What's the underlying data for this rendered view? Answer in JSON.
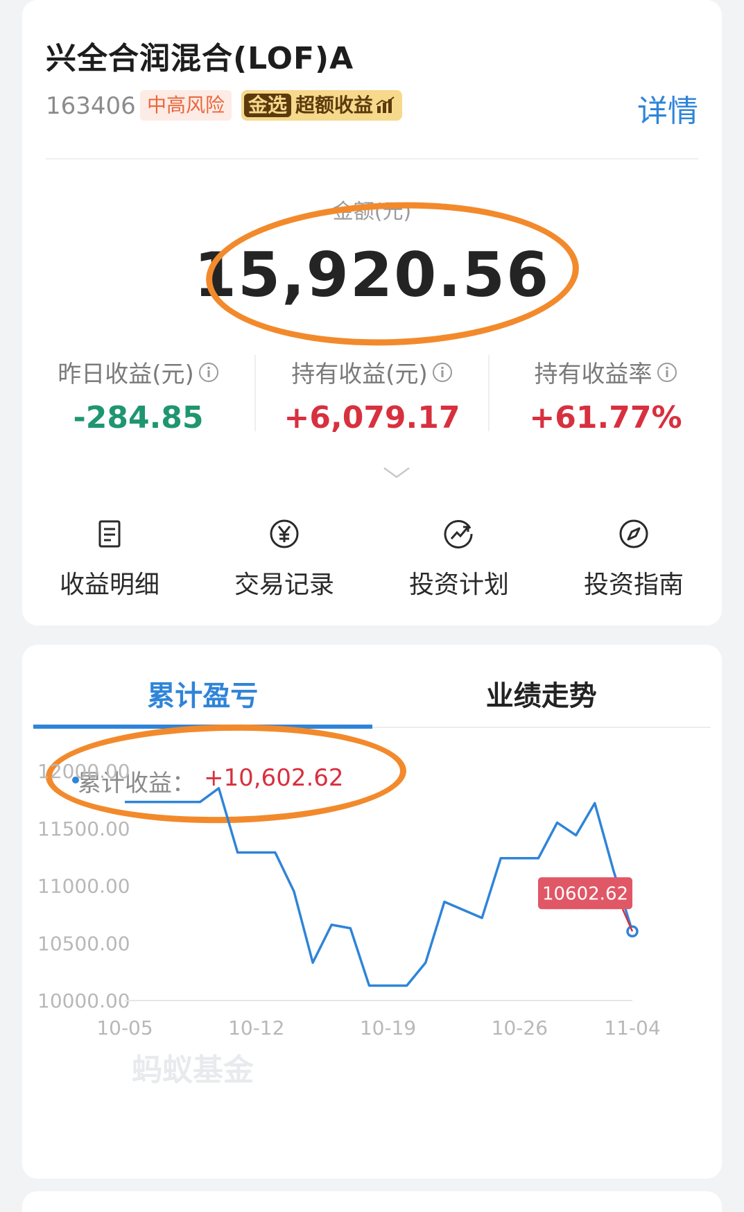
{
  "fund": {
    "name": "兴全合润混合(LOF)A",
    "code": "163406",
    "risk": "中高风险",
    "gold_tag": "金选",
    "gold_text": "超额收益",
    "detail_link": "详情"
  },
  "holding": {
    "amount_label": "金额(元)",
    "amount": "15,920.56",
    "stats": [
      {
        "label": "昨日收益(元)",
        "value": "-284.85",
        "sign": "neg"
      },
      {
        "label": "持有收益(元)",
        "value": "+6,079.17",
        "sign": "pos"
      },
      {
        "label": "持有收益率",
        "value": "+61.77%",
        "sign": "pos"
      }
    ]
  },
  "actions": [
    {
      "label": "收益明细",
      "icon": "document-icon"
    },
    {
      "label": "交易记录",
      "icon": "yen-circle-icon"
    },
    {
      "label": "投资计划",
      "icon": "trend-circle-icon"
    },
    {
      "label": "投资指南",
      "icon": "compass-icon"
    }
  ],
  "tabs": [
    {
      "label": "累计盈亏",
      "active": true
    },
    {
      "label": "业绩走势",
      "active": false
    }
  ],
  "cumulative": {
    "label": "累计收益：",
    "value": "+10,602.62"
  },
  "colors": {
    "accent": "#2f84d8",
    "positive": "#d8303e",
    "negative": "#1f9670",
    "highlight": "#f28a2c"
  },
  "chart_data": {
    "type": "line",
    "watermark": "蚂蚁基金",
    "x_ticks": [
      "10-05",
      "10-12",
      "10-19",
      "10-26",
      "11-04"
    ],
    "y_ticks": [
      "12000.00",
      "11500.00",
      "11000.00",
      "10500.00",
      "10000.00"
    ],
    "ylim": [
      10000,
      12000
    ],
    "x": [
      "10-05",
      "10-06",
      "10-07",
      "10-08",
      "10-09",
      "10-10",
      "10-11",
      "10-12",
      "10-13",
      "10-14",
      "10-15",
      "10-16",
      "10-17",
      "10-18",
      "10-19",
      "10-20",
      "10-21",
      "10-22",
      "10-23",
      "10-24",
      "10-25",
      "10-26",
      "10-27",
      "10-28",
      "10-29",
      "10-30",
      "11-01",
      "11-04"
    ],
    "series": [
      {
        "values": [
          11730,
          11730,
          11730,
          11730,
          11730,
          11850,
          11290,
          11290,
          11290,
          10950,
          10330,
          10660,
          10630,
          10130,
          10130,
          10130,
          10330,
          10860,
          10790,
          10720,
          11240,
          11240,
          11240,
          11550,
          11440,
          11720,
          11130,
          10602.62
        ]
      }
    ],
    "last_value_label": "10602.62"
  }
}
